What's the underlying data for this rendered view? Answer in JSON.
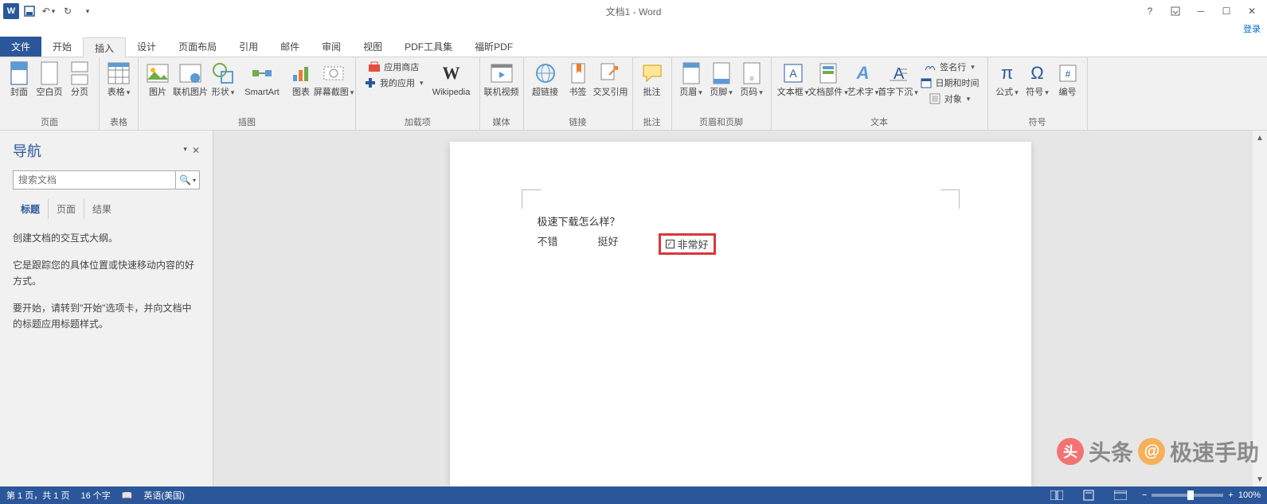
{
  "title": "文档1 - Word",
  "login": "登录",
  "tabs": {
    "file": "文件",
    "home": "开始",
    "insert": "插入",
    "design": "设计",
    "layout": "页面布局",
    "ref": "引用",
    "mail": "邮件",
    "review": "审阅",
    "view": "视图",
    "pdf": "PDF工具集",
    "foxit": "福昕PDF"
  },
  "ribbon": {
    "pages": {
      "cover": "封面",
      "blank": "空白页",
      "break": "分页",
      "label": "页面"
    },
    "tables": {
      "table": "表格",
      "label": "表格"
    },
    "illus": {
      "pic": "图片",
      "online": "联机图片",
      "shapes": "形状",
      "smartart": "SmartArt",
      "chart": "图表",
      "screenshot": "屏幕截图",
      "label": "插图"
    },
    "addins": {
      "store": "应用商店",
      "myaddins": "我的应用",
      "wiki": "Wikipedia",
      "label": "加载项"
    },
    "media": {
      "video": "联机视频",
      "label": "媒体"
    },
    "links": {
      "hyperlink": "超链接",
      "bookmark": "书签",
      "crossref": "交叉引用",
      "label": "链接"
    },
    "comments": {
      "comment": "批注",
      "label": "批注"
    },
    "hf": {
      "header": "页眉",
      "footer": "页脚",
      "pagenum": "页码",
      "label": "页眉和页脚"
    },
    "text": {
      "textbox": "文本框",
      "parts": "文档部件",
      "wordart": "艺术字",
      "dropcap": "首字下沉",
      "sig": "签名行",
      "datetime": "日期和时间",
      "object": "对象",
      "label": "文本"
    },
    "symbols": {
      "eq": "公式",
      "sym": "符号",
      "num": "编号",
      "label": "符号"
    }
  },
  "nav": {
    "title": "导航",
    "search_ph": "搜索文档",
    "tabs": {
      "headings": "标题",
      "pages": "页面",
      "results": "结果"
    },
    "text1": "创建文档的交互式大纲。",
    "text2": "它是跟踪您的具体位置或快速移动内容的好方式。",
    "text3": "要开始，请转到\"开始\"选项卡，并向文档中的标题应用标题样式。"
  },
  "doc": {
    "q": "极速下载怎么样？",
    "a1": "不错",
    "a2": "挺好",
    "a3": "非常好"
  },
  "status": {
    "page": "第 1 页，共 1 页",
    "words": "16 个字",
    "lang": "英语(美国)",
    "zoom": "100%"
  },
  "watermark": {
    "t1": "头条",
    "t2": "极速手助"
  }
}
